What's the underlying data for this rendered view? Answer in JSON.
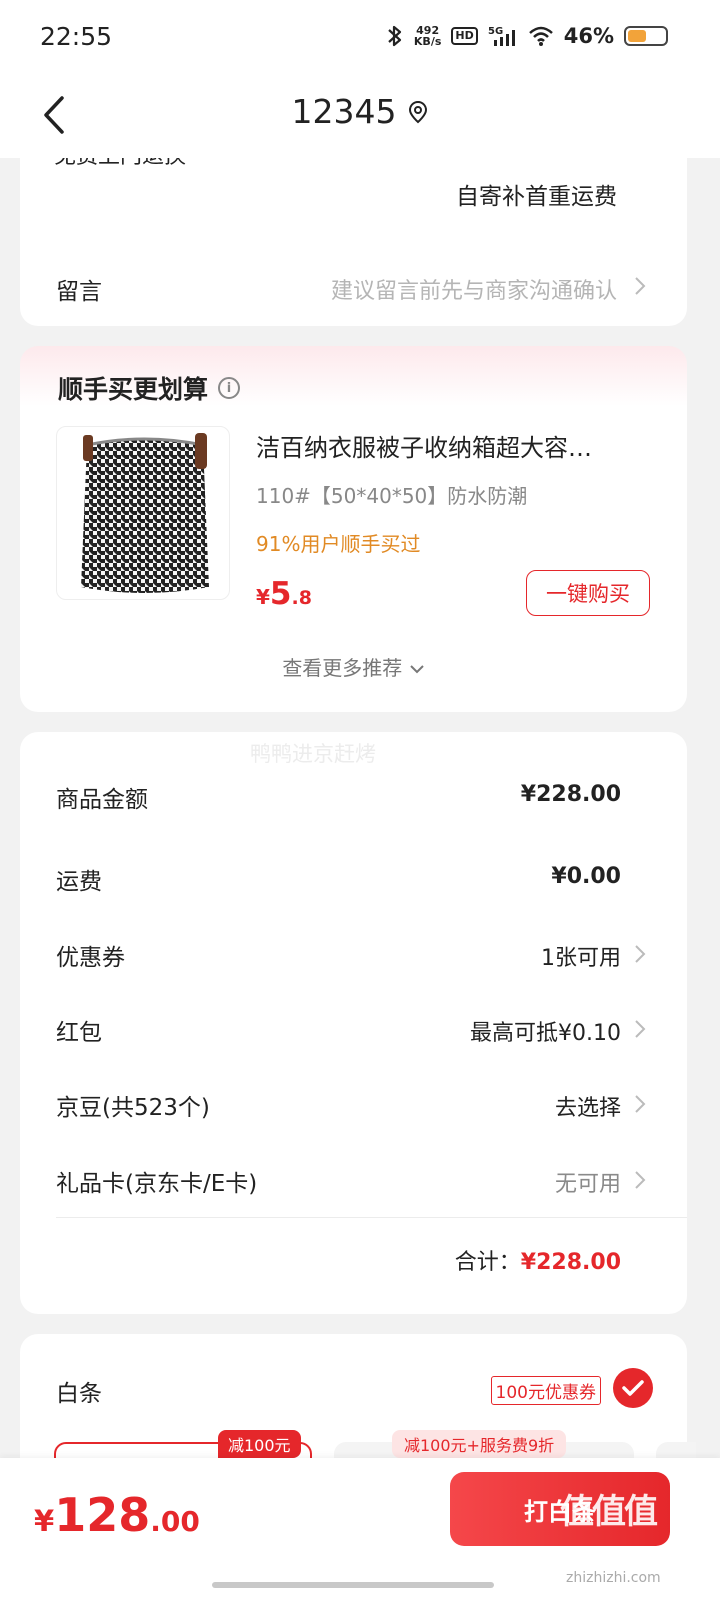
{
  "status_bar": {
    "time": "22:55",
    "net_speed_value": "492",
    "net_speed_unit": "KB/s",
    "hd": "HD",
    "network": "5G",
    "battery": "46%",
    "battery_level": 0.46
  },
  "nav": {
    "title": "12345"
  },
  "shipping": {
    "clipped_row_text": "免费上门退换",
    "note": "自寄补首重运费"
  },
  "message": {
    "label": "留言",
    "placeholder": "建议留言前先与商家沟通确认"
  },
  "recommend": {
    "title": "顺手买更划算",
    "product_name": "洁百纳衣服被子收纳箱超大容…",
    "product_spec": "110#【50*40*50】防水防潮",
    "social_proof": "91%用户顺手买过",
    "price_currency": "¥",
    "price_int": "5",
    "price_dec": ".8",
    "buy_label": "一键购买",
    "more_label": "查看更多推荐"
  },
  "watermark": "鸭鸭进京赶烤",
  "fees": {
    "rows": [
      {
        "label": "商品金额",
        "value": "¥228.00"
      },
      {
        "label": "运费",
        "value": "¥0.00"
      },
      {
        "label": "优惠券",
        "value": "1张可用"
      },
      {
        "label": "红包",
        "value": "最高可抵¥0.10"
      },
      {
        "label": "京豆(共523个)",
        "value": "去选择"
      },
      {
        "label": "礼品卡(京东卡/E卡)",
        "value": "无可用"
      }
    ],
    "total_label": "合计：",
    "total_value": "¥228.00"
  },
  "baitiao": {
    "label": "白条",
    "coupon": "100元优惠券",
    "tag1": "减100元",
    "tag2": "减100元+服务费9折"
  },
  "bottom": {
    "price_currency": "¥",
    "price_int": "128",
    "price_dec": ".00",
    "pay_label": "打白条",
    "logo_text": "值值值",
    "logo_url": "zhizhizhi.com"
  },
  "colors": {
    "accent": "#e5272b",
    "social_proof": "#e18a24"
  }
}
